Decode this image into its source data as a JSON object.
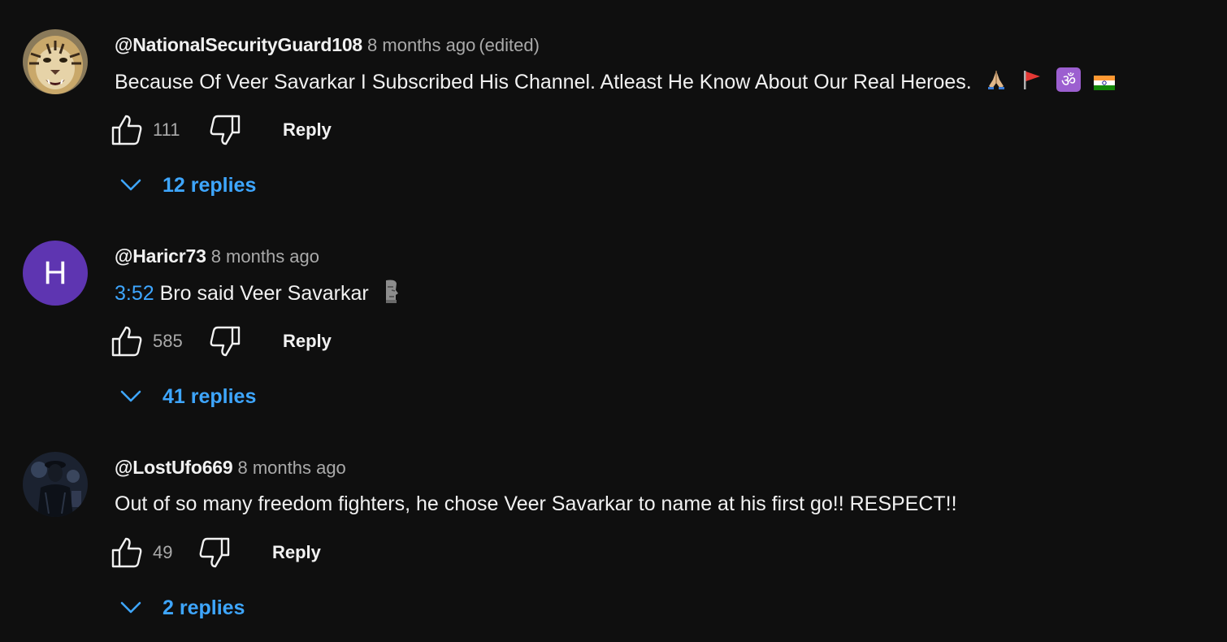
{
  "colors": {
    "background": "#0f0f0f",
    "primary_text": "#f1f1f1",
    "secondary_text": "#aaaaaa",
    "link_blue": "#3ea6ff",
    "avatar_purple": "#5e35b1"
  },
  "comments": [
    {
      "author": "@NationalSecurityGuard108",
      "time": "8 months ago",
      "edited": "(edited)",
      "text": "Because Of Veer Savarkar I Subscribed His Channel. Atleast He Know About Our Real Heroes.",
      "emojis": [
        "folded-hands",
        "red-flag",
        "om-symbol",
        "india-flag"
      ],
      "avatar": "tiger-photo",
      "likes": "111",
      "reply_label": "Reply",
      "replies_label": "12 replies"
    },
    {
      "author": "@Haricr73",
      "time": "8 months ago",
      "timestamp": "3:52",
      "text": " Bro said Veer Savarkar",
      "emojis": [
        "moai"
      ],
      "avatar_letter": "H",
      "likes": "585",
      "reply_label": "Reply",
      "replies_label": "41 replies"
    },
    {
      "author": "@LostUfo669",
      "time": "8 months ago",
      "text": "Out of so many freedom fighters, he chose Veer Savarkar to name at his first go!! RESPECT!!",
      "avatar": "dark-figure-photo",
      "likes": "49",
      "reply_label": "Reply",
      "replies_label": "2 replies"
    }
  ]
}
